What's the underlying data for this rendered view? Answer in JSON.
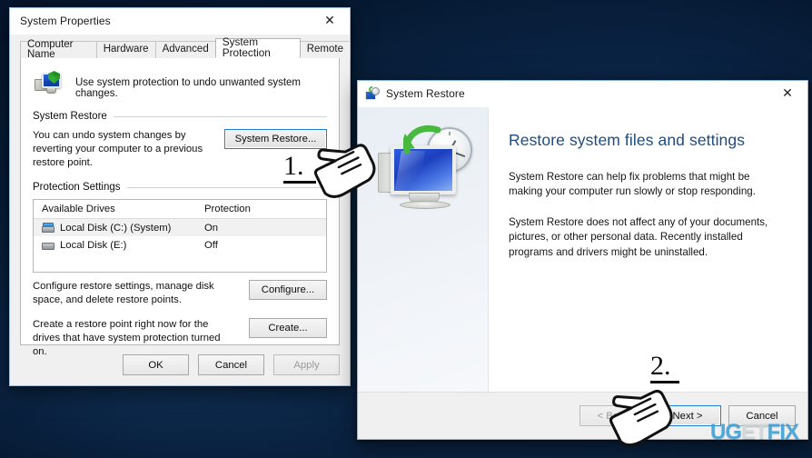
{
  "desktop": {
    "background_color": "#0a2240",
    "watermark": {
      "part1": "UG",
      "part2": "ET",
      "part3": "FIX",
      "full": "UGETFIX"
    }
  },
  "system_properties": {
    "title": "System Properties",
    "close_icon": "close-icon",
    "tabs": [
      {
        "label": "Computer Name",
        "active": false
      },
      {
        "label": "Hardware",
        "active": false
      },
      {
        "label": "Advanced",
        "active": false
      },
      {
        "label": "System Protection",
        "active": true
      },
      {
        "label": "Remote",
        "active": false
      }
    ],
    "header_text": "Use system protection to undo unwanted system changes.",
    "header_icon": "monitor-shield-icon",
    "system_restore_group": {
      "label": "System Restore",
      "description": "You can undo system changes by reverting your computer to a previous restore point.",
      "button": "System Restore..."
    },
    "protection_settings_group": {
      "label": "Protection Settings",
      "columns": [
        "Available Drives",
        "Protection"
      ],
      "rows": [
        {
          "drive": "Local Disk (C:) (System)",
          "protection": "On",
          "selected": true,
          "icon": "system-drive-icon"
        },
        {
          "drive": "Local Disk (E:)",
          "protection": "Off",
          "selected": false,
          "icon": "drive-icon"
        }
      ],
      "configure_description": "Configure restore settings, manage disk space, and delete restore points.",
      "configure_button": "Configure...",
      "create_description": "Create a restore point right now for the drives that have system protection turned on.",
      "create_button": "Create..."
    },
    "dialog_buttons": [
      {
        "label": "OK",
        "disabled": false
      },
      {
        "label": "Cancel",
        "disabled": false
      },
      {
        "label": "Apply",
        "disabled": true
      }
    ]
  },
  "system_restore": {
    "title": "System Restore",
    "title_icon": "system-restore-icon",
    "close_icon": "close-icon",
    "illustration_icon": "monitor-clock-restore-icon",
    "heading": "Restore system files and settings",
    "paragraph1": "System Restore can help fix problems that might be making your computer run slowly or stop responding.",
    "paragraph2": "System Restore does not affect any of your documents, pictures, or other personal data. Recently installed programs and drivers might be uninstalled.",
    "footer_buttons": [
      {
        "label": "< Back",
        "disabled": true,
        "focused": false
      },
      {
        "label": "Next >",
        "disabled": false,
        "focused": true
      },
      {
        "label": "Cancel",
        "disabled": false,
        "focused": false
      }
    ]
  },
  "annotations": [
    {
      "id": "step1",
      "label": "1.",
      "cursor": "hand-pointer-cursor"
    },
    {
      "id": "step2",
      "label": "2.",
      "cursor": "hand-pointer-cursor"
    }
  ]
}
